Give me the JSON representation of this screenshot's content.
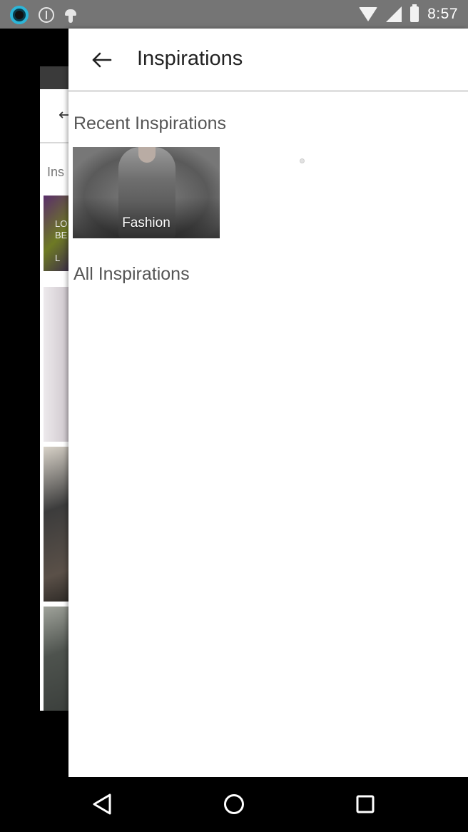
{
  "status_bar": {
    "time": "8:57",
    "icons": [
      "ring-app-icon",
      "info-icon",
      "android-icon",
      "wifi-icon",
      "signal-icon",
      "battery-icon"
    ]
  },
  "background_screen": {
    "label_partial": "Ins",
    "thumb_text_partial": "LO\nBE\n\nL"
  },
  "drawer": {
    "title": "Inspirations",
    "back_icon": "arrow-left-icon",
    "sections": {
      "recent": {
        "title": "Recent Inspirations",
        "tiles": [
          {
            "label": "Fashion"
          }
        ]
      },
      "all": {
        "title": "All Inspirations"
      }
    }
  },
  "nav_bar": {
    "icons": [
      "back-triangle-icon",
      "home-circle-icon",
      "recents-square-icon"
    ]
  },
  "colors": {
    "status_bar": "#757575",
    "drawer_bg": "#ffffff",
    "section_title": "#555555",
    "title_text": "#222222"
  }
}
